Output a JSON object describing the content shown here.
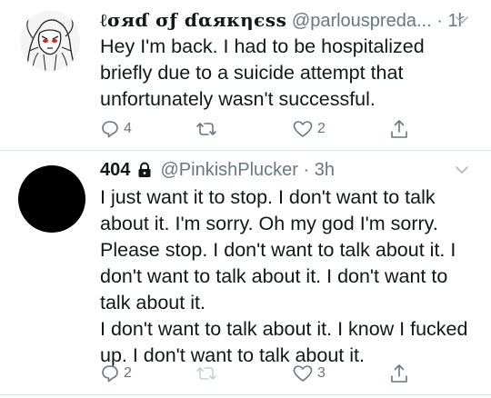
{
  "tweets": [
    {
      "display_name": "ℓσяɗ σƒ ɗαякηєѕѕ",
      "handle": "@parlouspreda...",
      "separator": "·",
      "time": "1h",
      "protected": false,
      "avatar": "drawn-character-avatar",
      "text": [
        "Hey I'm back. I had to be hospitalized briefly due to a suicide attempt that unfortunately wasn't successful."
      ],
      "reply_count": "4",
      "retweet_count": "",
      "like_count": "2"
    },
    {
      "display_name": "404",
      "handle": "@PinkishPlucker",
      "separator": "·",
      "time": "3h",
      "protected": true,
      "avatar": "black-circle-avatar",
      "text": [
        "I just want it to stop. I don't want to talk about it. I'm sorry. Oh my god I'm sorry. Please stop. I don't want to talk about it. I don't want to talk about it. I don't want to talk about it.",
        "I don't want to talk about it. I know I fucked up. I don't want to talk about it."
      ],
      "reply_count": "2",
      "retweet_count": "",
      "like_count": "3"
    }
  ],
  "colors": {
    "text": "#14171a",
    "secondary": "#657786",
    "divider": "#e1e8ed",
    "disabled_icon": "#c5d0d8"
  }
}
